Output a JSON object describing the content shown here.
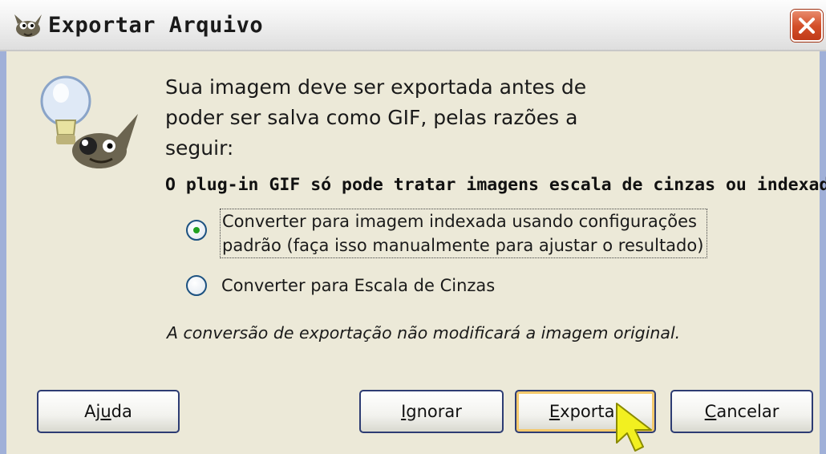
{
  "window": {
    "title": "Exportar Arquivo",
    "close_label": "Fechar"
  },
  "message": {
    "intro_line1": "Sua imagem deve ser exportada antes de",
    "intro_line2": "poder ser salva como GIF, pelas razões a",
    "intro_line3": "seguir:",
    "reason": "O plug-in GIF só pode tratar imagens escala de cinzas ou indexadas",
    "note": "A conversão de exportação não modificará a imagem original."
  },
  "options": {
    "indexed_line1": "Converter para imagem indexada usando configurações",
    "indexed_line2": "padrão (faça isso manualmente para ajustar o resultado)",
    "grayscale": "Converter para Escala de Cinzas",
    "selected": "indexed"
  },
  "buttons": {
    "help_pre": "Aj",
    "help_u": "u",
    "help_post": "da",
    "ignore_u": "I",
    "ignore_post": "gnorar",
    "export_u": "E",
    "export_post": "xportar",
    "cancel_u": "C",
    "cancel_post": "ancelar"
  },
  "colors": {
    "radio_selected": "#21a121",
    "focus_ring": "#f4c96c",
    "close_button": "#d4502a"
  },
  "icons": {
    "title": "gimp-wilber-icon",
    "dialog": "gimp-lightbulb-mascot-icon",
    "close": "close-icon",
    "cursor": "mouse-pointer-icon"
  }
}
